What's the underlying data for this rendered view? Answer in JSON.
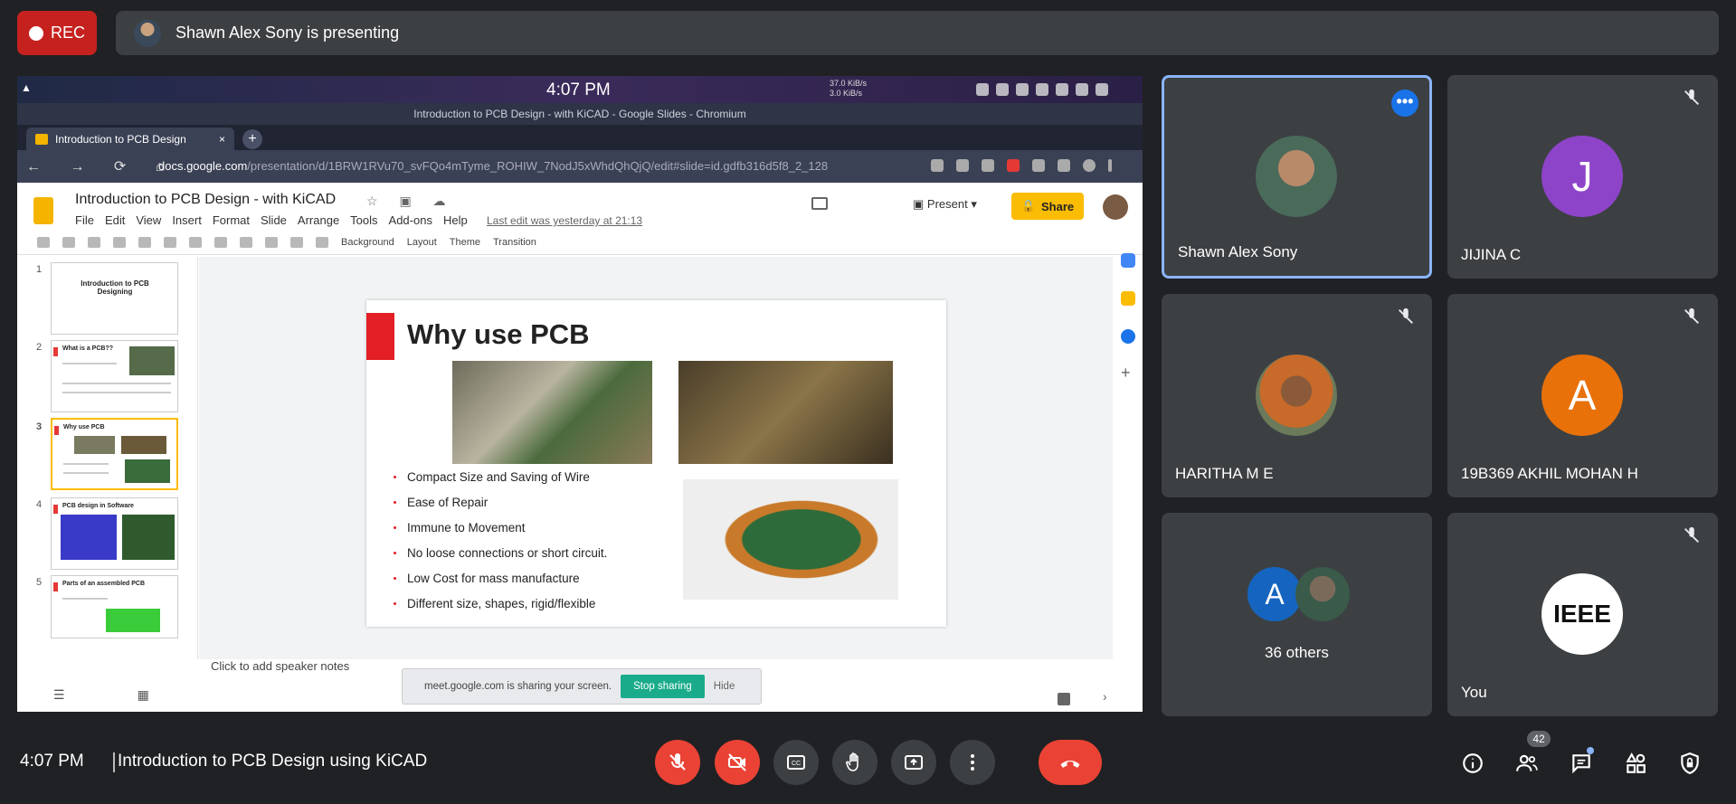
{
  "top": {
    "rec_label": "REC",
    "presenting_text": "Shawn Alex Sony is presenting"
  },
  "shared_screen": {
    "system_time": "4:07 PM",
    "net_up": "37.0 KiB/s",
    "net_down": "3.0 KiB/s",
    "window_title": "Introduction to PCB Design - with KiCAD - Google Slides - Chromium",
    "tab_title": "Introduction to PCB Design",
    "tab_close": "×",
    "new_tab": "+",
    "nav_buttons": "← → ⟳ ⌂",
    "url_host": "docs.google.com",
    "url_path": "/presentation/d/1BRW1RVu70_svFQo4mTyme_ROHIW_7NodJ5xWhdQhQjQ/edit#slide=id.gdfb316d5f8_2_128",
    "slides": {
      "doc_title": "Introduction to PCB Design - with KiCAD",
      "title_icons": "☆ ▣ ☁",
      "menu": [
        "File",
        "Edit",
        "View",
        "Insert",
        "Format",
        "Slide",
        "Arrange",
        "Tools",
        "Add-ons",
        "Help"
      ],
      "last_edit": "Last edit was yesterday at 21:13",
      "present_label": "Present",
      "share_label": "Share",
      "toolbar": {
        "background": "Background",
        "layout": "Layout",
        "theme": "Theme",
        "transition": "Transition"
      },
      "filmstrip": [
        {
          "num": "1",
          "title": "Introduction to PCB Designing"
        },
        {
          "num": "2",
          "title": "What is a PCB??"
        },
        {
          "num": "3",
          "title": "Why use PCB"
        },
        {
          "num": "4",
          "title": "PCB design in Software"
        },
        {
          "num": "5",
          "title": "Parts of an assembled PCB"
        }
      ],
      "slide": {
        "title": "Why use PCB",
        "bullets": [
          "Compact Size and Saving of Wire",
          "Ease of Repair",
          "Immune to Movement",
          "No loose connections or short circuit.",
          "Low Cost for mass manufacture",
          "Different size, shapes, rigid/flexible"
        ]
      },
      "speaker_notes": "Click to add speaker notes"
    },
    "sharing_bar": {
      "message": "meet.google.com is sharing your screen.",
      "stop": "Stop sharing",
      "hide": "Hide"
    }
  },
  "participants": [
    {
      "name": "Shawn Alex Sony",
      "kind": "photo",
      "color": "#6b4e3d",
      "muted": false,
      "speaking": true
    },
    {
      "name": "JIJINA C",
      "kind": "letter",
      "letter": "J",
      "color": "#8e44c9",
      "muted": true
    },
    {
      "name": "HARITHA M E",
      "kind": "photo",
      "color": "#a0603a",
      "muted": true
    },
    {
      "name": "19B369 AKHIL MOHAN H",
      "kind": "letter",
      "letter": "A",
      "color": "#e8710a",
      "muted": true
    },
    {
      "name": "36 others",
      "kind": "group",
      "letter": "A",
      "color": "#1565c0",
      "muted": false
    },
    {
      "name": "You",
      "kind": "logo",
      "logo_text": "IEEE",
      "muted": true
    }
  ],
  "more_options": "•••",
  "bottom": {
    "time": "4:07 PM",
    "meeting_name": "Introduction to PCB Design using KiCAD",
    "people_count": "42"
  },
  "colors": {
    "background": "#202124",
    "tile": "#3c4043",
    "danger": "#ea4335",
    "accent": "#8ab4f8"
  }
}
